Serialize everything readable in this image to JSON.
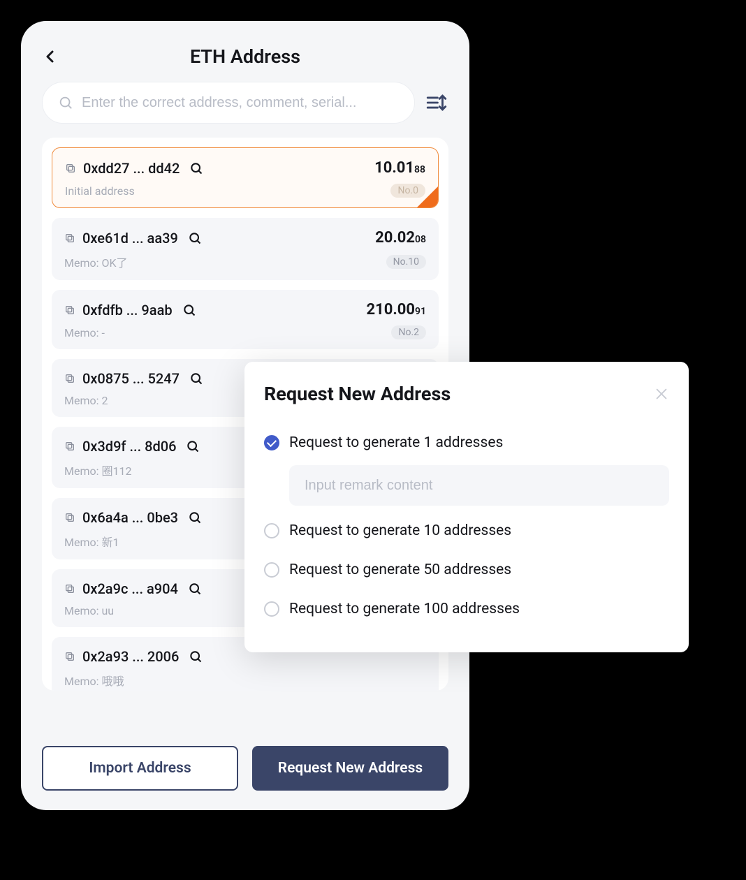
{
  "header": {
    "title": "ETH Address"
  },
  "search": {
    "placeholder": "Enter the correct address, comment, serial..."
  },
  "addresses": [
    {
      "addr": "0xdd27 ... dd42",
      "balance_main": "10.01",
      "balance_cents": "88",
      "memo": "Initial address",
      "no": "No.0",
      "selected": true
    },
    {
      "addr": "0xe61d ... aa39",
      "balance_main": "20.02",
      "balance_cents": "08",
      "memo": "Memo: OK了",
      "no": "No.10",
      "selected": false
    },
    {
      "addr": "0xfdfb ... 9aab",
      "balance_main": "210.00",
      "balance_cents": "91",
      "memo": "Memo: -",
      "no": "No.2",
      "selected": false
    },
    {
      "addr": "0x0875 ... 5247",
      "balance_main": "",
      "balance_cents": "",
      "memo": "Memo: 2",
      "no": "",
      "selected": false
    },
    {
      "addr": "0x3d9f ... 8d06",
      "balance_main": "",
      "balance_cents": "",
      "memo": "Memo: 圈112",
      "no": "",
      "selected": false
    },
    {
      "addr": "0x6a4a ... 0be3",
      "balance_main": "",
      "balance_cents": "",
      "memo": "Memo: 新1",
      "no": "",
      "selected": false
    },
    {
      "addr": "0x2a9c ... a904",
      "balance_main": "",
      "balance_cents": "",
      "memo": "Memo: uu",
      "no": "",
      "selected": false
    },
    {
      "addr": "0x2a93 ... 2006",
      "balance_main": "",
      "balance_cents": "",
      "memo": "Memo: 哦哦",
      "no": "",
      "selected": false
    }
  ],
  "actions": {
    "import": "Import Address",
    "request": "Request New Address"
  },
  "modal": {
    "title": "Request New Address",
    "remark_placeholder": "Input remark content",
    "options": [
      {
        "label": "Request to generate 1 addresses",
        "checked": true
      },
      {
        "label": "Request to generate 10 addresses",
        "checked": false
      },
      {
        "label": "Request to generate 50 addresses",
        "checked": false
      },
      {
        "label": "Request to generate 100 addresses",
        "checked": false
      }
    ]
  }
}
